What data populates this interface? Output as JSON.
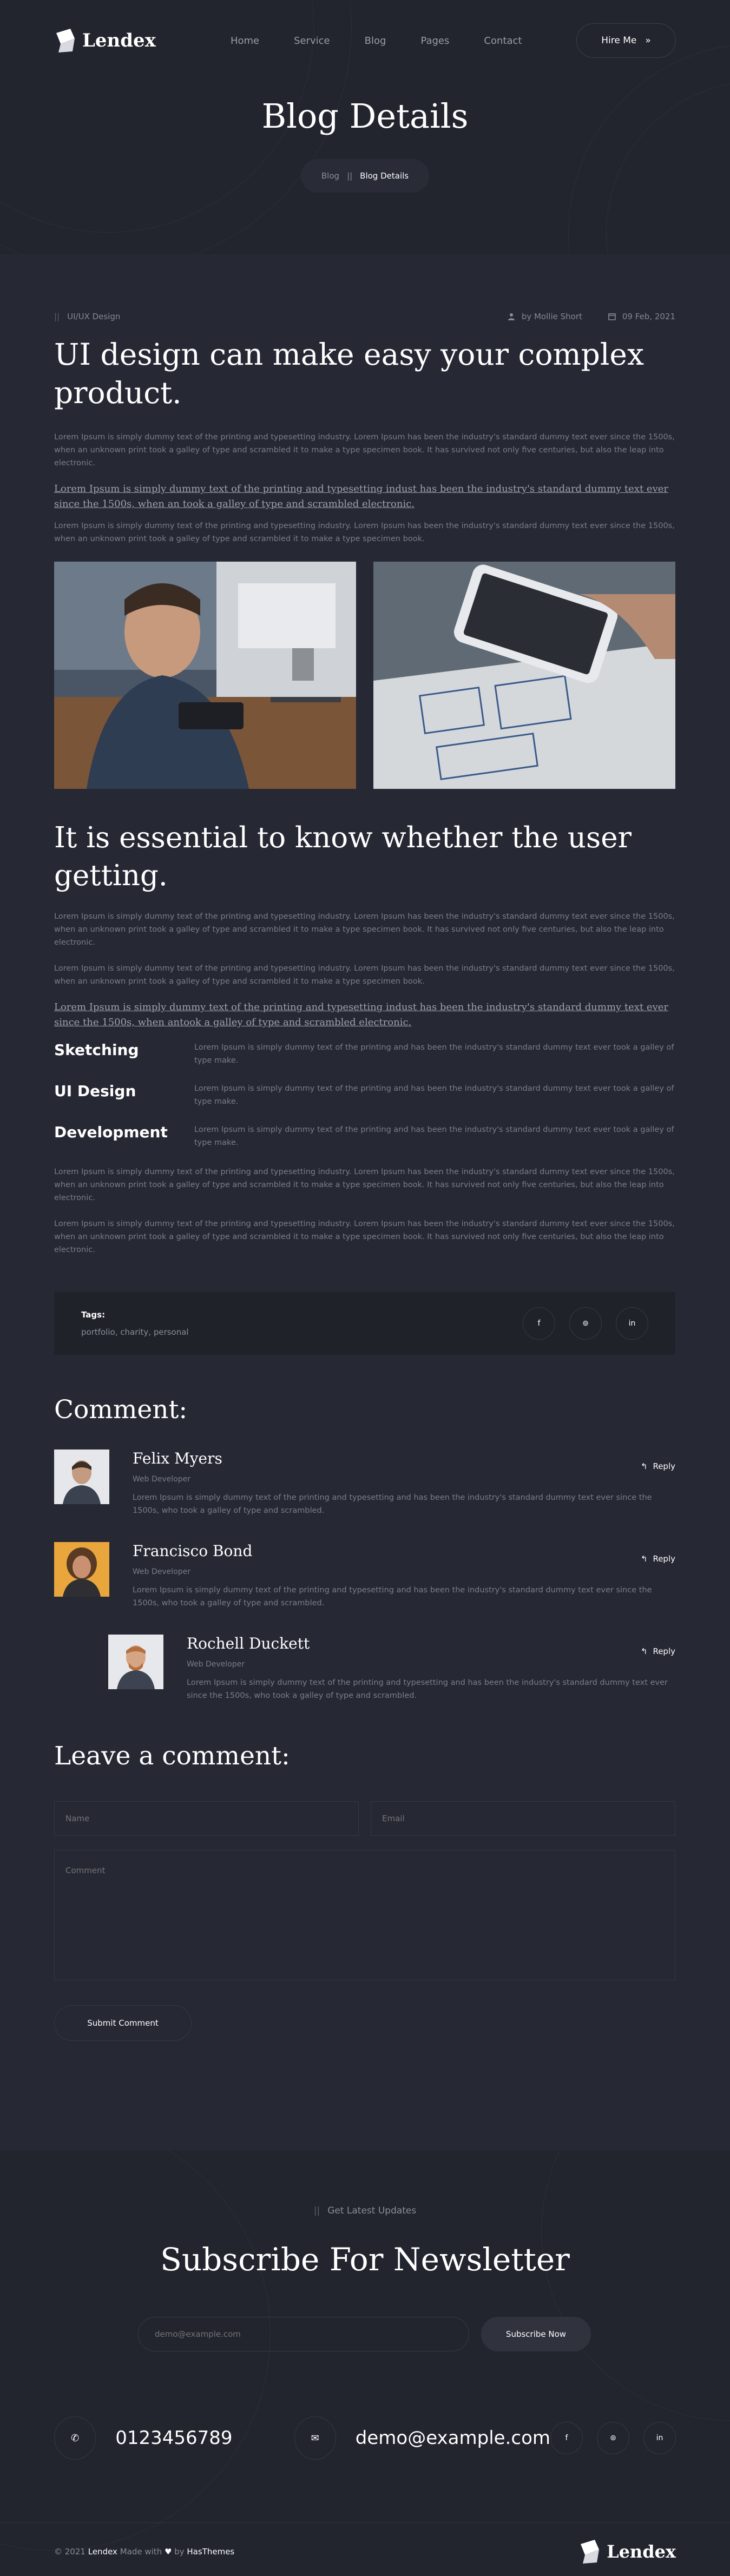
{
  "header": {
    "brand": "Lendex",
    "nav": [
      "Home",
      "Service",
      "Blog",
      "Pages",
      "Contact"
    ],
    "hire_label": "Hire Me",
    "hire_icon": "double-chevron-right-icon"
  },
  "hero": {
    "title": "Blog Details",
    "breadcrumb": {
      "home": "Blog",
      "separator": "||",
      "current": "Blog Details"
    }
  },
  "post": {
    "category": "UI/UX Design",
    "author": "by Mollie Short",
    "date": "09 Feb, 2021",
    "title": "UI design can make easy your complex product.",
    "para1": "Lorem Ipsum is simply dummy text of the printing and typesetting industry. Lorem Ipsum has been the industry's standard dummy text ever since the 1500s, when an unknown print took a galley of type and scrambled it to make a type specimen book. It has survived not only five centuries, but also the leap into electronic.",
    "quote1": "Lorem Ipsum is simply dummy text of the printing and typesetting indust has been the industry's standard dummy text ever since the 1500s, when an took a galley of type and scrambled electronic.",
    "para2": "Lorem Ipsum is simply dummy text of the printing and typesetting industry. Lorem Ipsum has been the industry's standard dummy text ever since the 1500s, when an unknown print took a galley of type and scrambled it to make a type specimen book.",
    "subtitle": "It is essential to know whether the user getting.",
    "para3": "Lorem Ipsum is simply dummy text of the printing and typesetting industry. Lorem Ipsum has been the industry's standard dummy text ever since the 1500s, when an unknown print took a galley of type and scrambled it to make a type specimen book. It has survived not only five centuries, but also the leap into electronic.",
    "para4": "Lorem Ipsum is simply dummy text of the printing and typesetting industry. Lorem Ipsum has been the industry's standard dummy text ever since the 1500s, when an unknown print took a galley of type and scrambled it to make a type specimen book.",
    "quote2": "Lorem Ipsum is simply dummy text of the printing and typesetting indust has been the industry's standard dummy text ever since the 1500s, when antook a galley of type and scrambled electronic.",
    "features": [
      {
        "title": "Sketching",
        "text": "Lorem Ipsum is simply dummy text of the printing and has been the industry's standard dummy text ever took a galley of type make."
      },
      {
        "title": "UI Design",
        "text": "Lorem Ipsum is simply dummy text of the printing and has been the industry's standard dummy text ever took a galley of type make."
      },
      {
        "title": "Development",
        "text": "Lorem Ipsum is simply dummy text of the printing and has been the industry's standard dummy text ever took a galley of type make."
      }
    ],
    "para5": "Lorem Ipsum is simply dummy text of the printing and typesetting industry. Lorem Ipsum has been the industry's standard dummy text ever since the 1500s, when an unknown print took a galley of type and scrambled it to make a type specimen book. It has survived not only five centuries, but also the leap into electronic.",
    "para6": "Lorem Ipsum is simply dummy text of the printing and typesetting industry. Lorem Ipsum has been the industry's standard dummy text ever since the 1500s, when an unknown print took a galley of type and scrambled it to make a type specimen book. It has survived not only five centuries, but also the leap into electronic.",
    "tags_label": "Tags:",
    "tags": "portfolio, charity, personal",
    "share_icons": [
      "facebook-icon",
      "pinterest-icon",
      "linkedin-icon"
    ],
    "share_glyphs": [
      "f",
      "⊚",
      "in"
    ]
  },
  "comments": {
    "title": "Comment:",
    "reply_label": "Reply",
    "items": [
      {
        "name": "Felix Myers",
        "role": "Web Developer",
        "text": "Lorem Ipsum is simply dummy text of the printing and typesetting and has been the industry's standard dummy text ever since the 1500s, who took a galley of type and scrambled."
      },
      {
        "name": "Francisco Bond",
        "role": "Web Developer",
        "text": "Lorem Ipsum is simply dummy text of the printing and typesetting and has been the industry's standard dummy text ever since the 1500s, who took a galley of type and scrambled."
      },
      {
        "name": "Rochell Duckett",
        "role": "Web Developer",
        "text": "Lorem Ipsum is simply dummy text of the printing and typesetting and has been the industry's standard dummy text ever since the 1500s, who took a galley of type and scrambled."
      }
    ]
  },
  "form": {
    "title": "Leave a comment:",
    "name_placeholder": "Name",
    "email_placeholder": "Email",
    "comment_placeholder": "Comment",
    "submit_label": "Submit Comment"
  },
  "newsletter": {
    "label": "Get Latest Updates",
    "title": "Subscribe For Newsletter",
    "placeholder": "demo@example.com",
    "button": "Subscribe Now"
  },
  "contact": {
    "phone": "0123456789",
    "email": "demo@example.com"
  },
  "footer": {
    "copy_prefix": "© 2021",
    "brand": "Lendex",
    "made_with": "Made with",
    "by": "by",
    "company": "HasThemes"
  },
  "colors": {
    "background": "#262834",
    "hero_background": "#22242e",
    "heading": "#ffffff",
    "body_text": "#7b7d89"
  }
}
